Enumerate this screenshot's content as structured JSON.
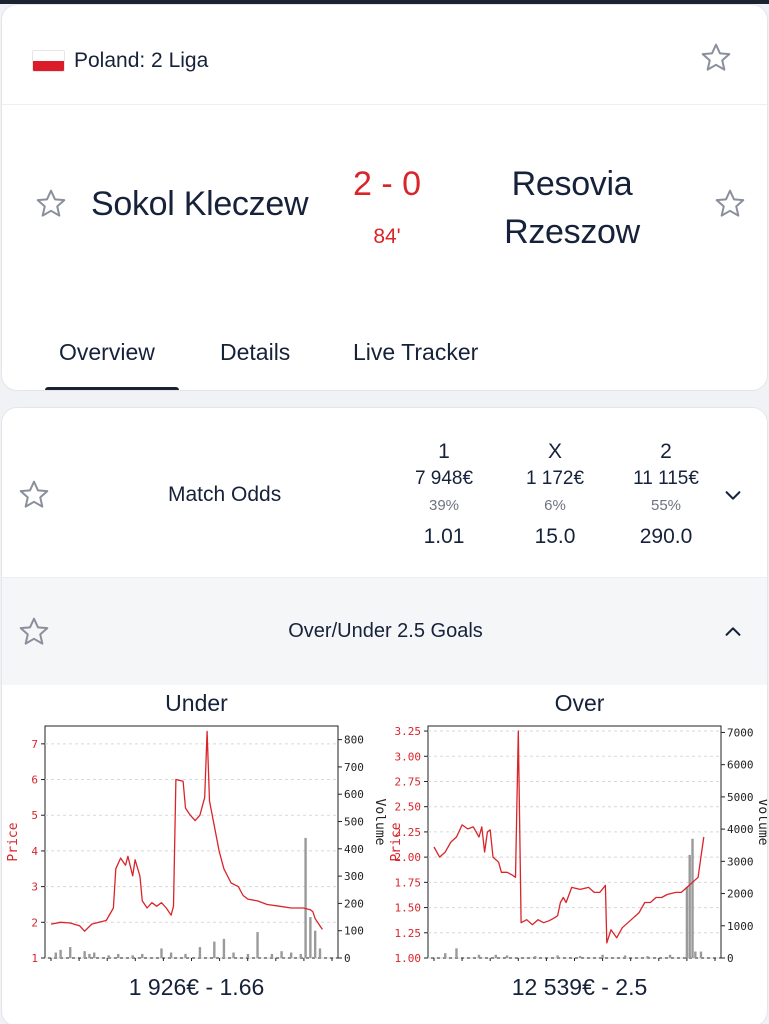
{
  "league": {
    "name": "Poland: 2 Liga",
    "flag_colors": [
      "#ffffff",
      "#dc1c2b"
    ]
  },
  "match": {
    "home_team": "Sokol Kleczew",
    "away_team_line1": "Resovia",
    "away_team_line2": "Rzeszow",
    "score": "2 - 0",
    "minute": "84'"
  },
  "tabs": [
    {
      "label": "Overview",
      "active": true
    },
    {
      "label": "Details",
      "active": false
    },
    {
      "label": "Live Tracker",
      "active": false
    }
  ],
  "markets": {
    "match_odds": {
      "title": "Match Odds",
      "icon": "chevron-down-icon",
      "columns": [
        {
          "header": "1",
          "volume": "7 948€",
          "percent": "39%",
          "odds": "1.01"
        },
        {
          "header": "X",
          "volume": "1 172€",
          "percent": "6%",
          "odds": "15.0"
        },
        {
          "header": "2",
          "volume": "11 115€",
          "percent": "55%",
          "odds": "290.0"
        }
      ]
    },
    "over_under": {
      "title": "Over/Under 2.5 Goals",
      "icon": "chevron-up-icon"
    }
  },
  "colors": {
    "accent_red": "#d9242a",
    "text_dark": "#16213a",
    "volume_bar": "#9a9a9a"
  },
  "chart_data": [
    {
      "type": "line",
      "title": "Under",
      "caption": "1 926€ - 1.66",
      "xlabel": "",
      "ylabel": "Price",
      "y2label": "Volume",
      "ylim": [
        1,
        7.5
      ],
      "yticks": [
        "1",
        "2",
        "3",
        "4",
        "5",
        "6",
        "7"
      ],
      "y2lim": [
        0,
        850
      ],
      "y2ticks": [
        "0",
        "100",
        "200",
        "300",
        "400",
        "500",
        "600",
        "700",
        "800"
      ],
      "price": [
        [
          0,
          1.95
        ],
        [
          4,
          2.0
        ],
        [
          8,
          1.98
        ],
        [
          12,
          1.9
        ],
        [
          14,
          1.75
        ],
        [
          17,
          1.95
        ],
        [
          20,
          2.0
        ],
        [
          23,
          2.05
        ],
        [
          26,
          2.4
        ],
        [
          27,
          3.5
        ],
        [
          29,
          3.8
        ],
        [
          31,
          3.6
        ],
        [
          32,
          3.85
        ],
        [
          34,
          3.3
        ],
        [
          35,
          3.75
        ],
        [
          37,
          3.3
        ],
        [
          38,
          2.6
        ],
        [
          40,
          2.4
        ],
        [
          42,
          2.55
        ],
        [
          44,
          2.45
        ],
        [
          46,
          2.55
        ],
        [
          48,
          2.4
        ],
        [
          50,
          2.2
        ],
        [
          51,
          2.45
        ],
        [
          52,
          6.0
        ],
        [
          55,
          5.95
        ],
        [
          56,
          5.2
        ],
        [
          58,
          5.0
        ],
        [
          60,
          4.85
        ],
        [
          62,
          5.0
        ],
        [
          64,
          5.5
        ],
        [
          65,
          7.35
        ],
        [
          66,
          5.4
        ],
        [
          68,
          4.7
        ],
        [
          70,
          4.0
        ],
        [
          72,
          3.5
        ],
        [
          75,
          3.1
        ],
        [
          78,
          3.0
        ],
        [
          80,
          2.75
        ],
        [
          82,
          2.65
        ],
        [
          86,
          2.6
        ],
        [
          90,
          2.5
        ],
        [
          95,
          2.45
        ],
        [
          100,
          2.4
        ],
        [
          105,
          2.4
        ],
        [
          108,
          2.35
        ],
        [
          109,
          2.3
        ],
        [
          110,
          2.1
        ],
        [
          112,
          1.9
        ],
        [
          113,
          1.8
        ]
      ],
      "volume": [
        [
          2,
          20
        ],
        [
          4,
          30
        ],
        [
          8,
          40
        ],
        [
          14,
          25
        ],
        [
          16,
          15
        ],
        [
          18,
          20
        ],
        [
          24,
          10
        ],
        [
          28,
          15
        ],
        [
          34,
          10
        ],
        [
          38,
          15
        ],
        [
          46,
          35
        ],
        [
          50,
          20
        ],
        [
          56,
          15
        ],
        [
          62,
          40
        ],
        [
          68,
          60
        ],
        [
          72,
          70
        ],
        [
          76,
          20
        ],
        [
          82,
          15
        ],
        [
          86,
          95
        ],
        [
          92,
          15
        ],
        [
          96,
          25
        ],
        [
          100,
          20
        ],
        [
          104,
          15
        ],
        [
          106,
          440
        ],
        [
          108,
          150
        ],
        [
          110,
          100
        ],
        [
          112,
          35
        ]
      ]
    },
    {
      "type": "line",
      "title": "Over",
      "caption": "12 539€ - 2.5",
      "xlabel": "",
      "ylabel": "Price",
      "y2label": "Volume",
      "ylim": [
        1.0,
        3.3
      ],
      "yticks": [
        "1.00",
        "1.25",
        "1.50",
        "1.75",
        "2.00",
        "2.25",
        "2.50",
        "2.75",
        "3.00",
        "3.25"
      ],
      "y2lim": [
        0,
        7200
      ],
      "y2ticks": [
        "0",
        "1000",
        "2000",
        "3000",
        "4000",
        "5000",
        "6000",
        "7000"
      ],
      "price": [
        [
          0,
          2.1
        ],
        [
          2,
          2.0
        ],
        [
          4,
          2.05
        ],
        [
          6,
          2.15
        ],
        [
          8,
          2.2
        ],
        [
          10,
          2.32
        ],
        [
          12,
          2.28
        ],
        [
          14,
          2.3
        ],
        [
          16,
          2.2
        ],
        [
          17,
          2.3
        ],
        [
          18,
          2.05
        ],
        [
          19,
          2.25
        ],
        [
          20,
          2.27
        ],
        [
          21,
          2.0
        ],
        [
          23,
          1.95
        ],
        [
          24,
          1.85
        ],
        [
          26,
          1.85
        ],
        [
          28,
          1.82
        ],
        [
          29,
          1.8
        ],
        [
          30,
          3.25
        ],
        [
          31,
          1.35
        ],
        [
          33,
          1.38
        ],
        [
          35,
          1.33
        ],
        [
          37,
          1.38
        ],
        [
          39,
          1.35
        ],
        [
          41,
          1.37
        ],
        [
          43,
          1.4
        ],
        [
          44,
          1.42
        ],
        [
          45,
          1.55
        ],
        [
          46,
          1.6
        ],
        [
          47,
          1.55
        ],
        [
          49,
          1.7
        ],
        [
          52,
          1.68
        ],
        [
          55,
          1.7
        ],
        [
          57,
          1.65
        ],
        [
          59,
          1.65
        ],
        [
          61,
          1.72
        ],
        [
          61.5,
          1.15
        ],
        [
          63,
          1.28
        ],
        [
          65,
          1.2
        ],
        [
          67,
          1.3
        ],
        [
          69,
          1.35
        ],
        [
          71,
          1.4
        ],
        [
          73,
          1.45
        ],
        [
          75,
          1.55
        ],
        [
          77,
          1.55
        ],
        [
          79,
          1.6
        ],
        [
          81,
          1.6
        ],
        [
          83,
          1.63
        ],
        [
          86,
          1.65
        ],
        [
          88,
          1.65
        ],
        [
          90,
          1.7
        ],
        [
          92,
          1.75
        ],
        [
          94,
          1.8
        ],
        [
          95,
          2.0
        ],
        [
          96,
          2.2
        ]
      ],
      "volume": [
        [
          4,
          150
        ],
        [
          8,
          300
        ],
        [
          16,
          100
        ],
        [
          22,
          100
        ],
        [
          26,
          80
        ],
        [
          36,
          60
        ],
        [
          44,
          80
        ],
        [
          52,
          60
        ],
        [
          60,
          100
        ],
        [
          68,
          80
        ],
        [
          76,
          60
        ],
        [
          84,
          100
        ],
        [
          90,
          2200
        ],
        [
          91,
          3200
        ],
        [
          92,
          3700
        ],
        [
          93,
          200
        ],
        [
          95,
          200
        ]
      ]
    }
  ]
}
